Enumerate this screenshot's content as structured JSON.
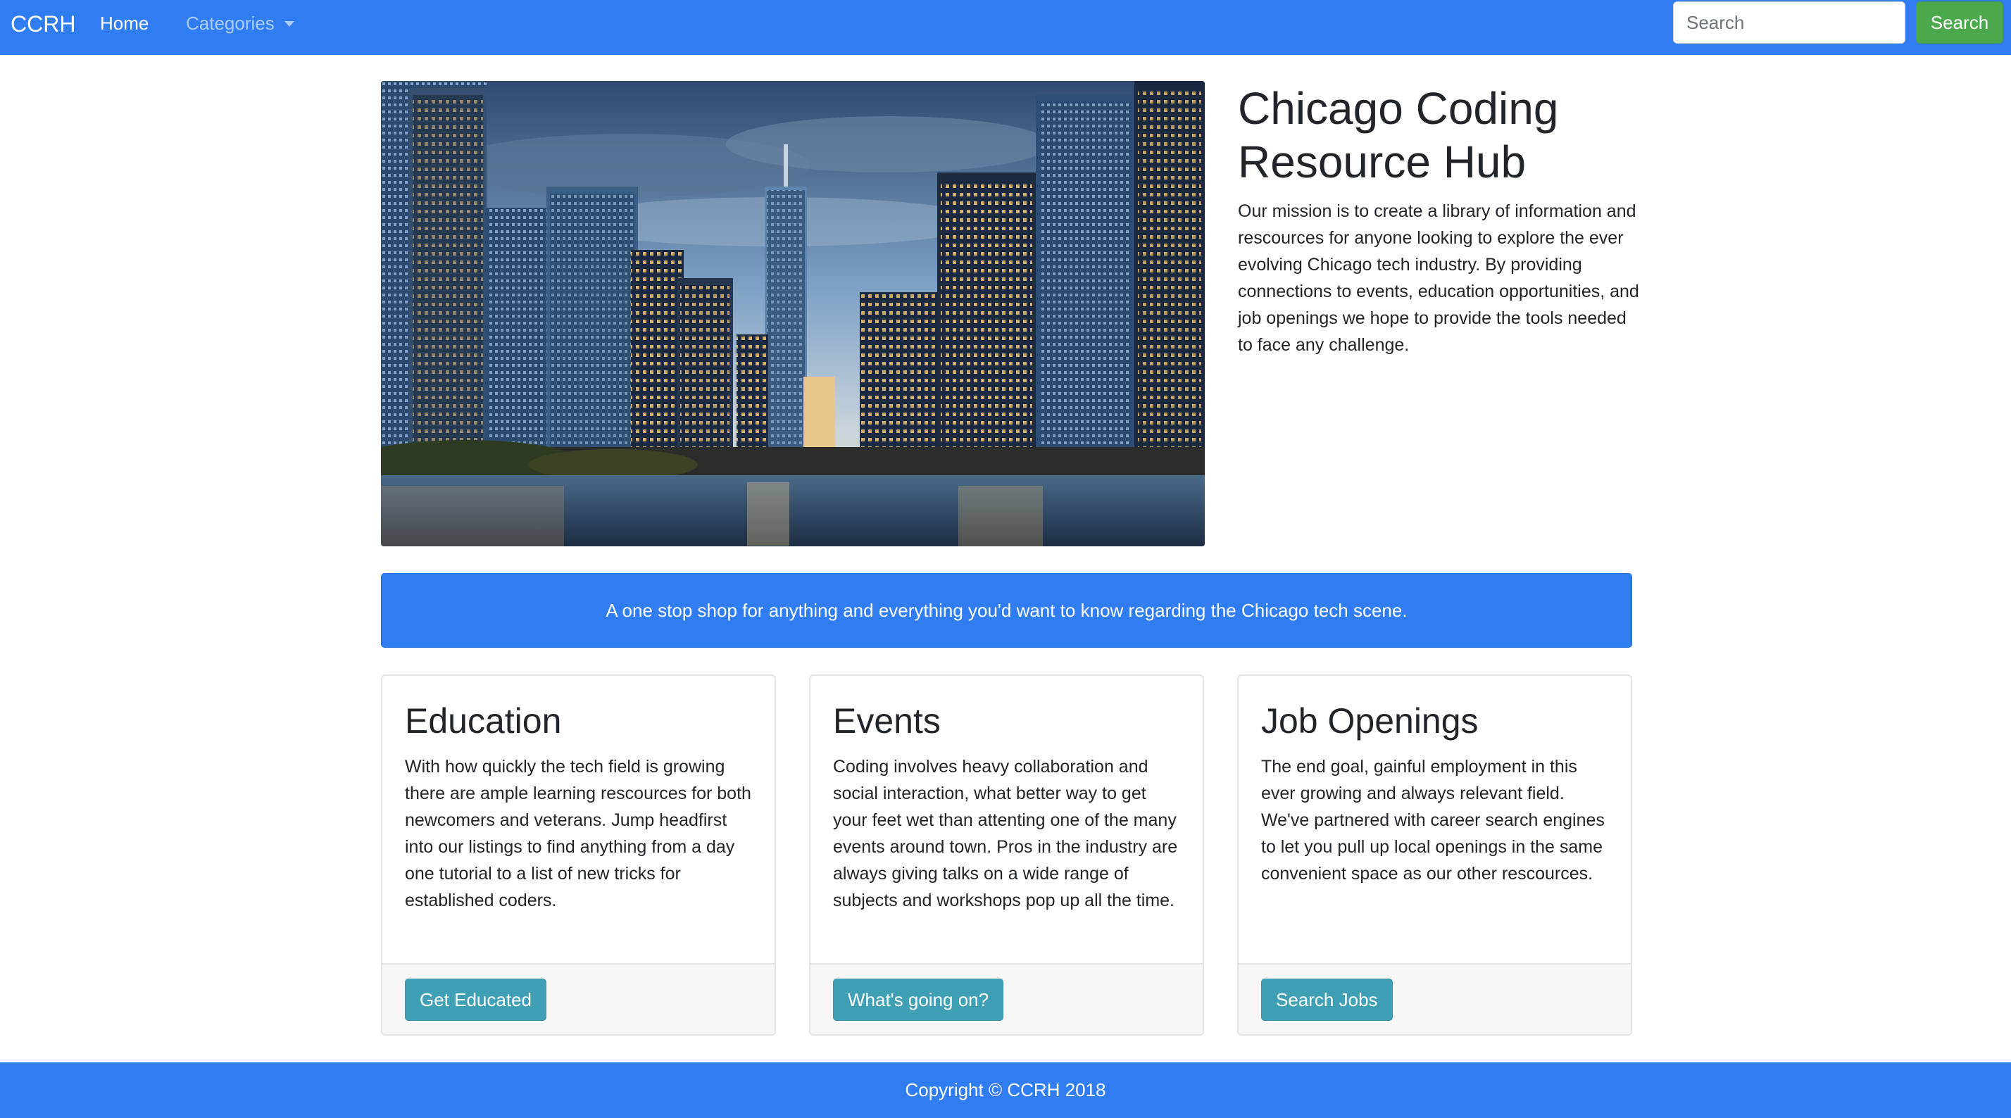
{
  "nav": {
    "brand": "CCRH",
    "home": "Home",
    "categories": "Categories",
    "search_placeholder": "Search",
    "search_button": "Search"
  },
  "hero": {
    "title": "Chicago Coding Resource Hub",
    "text": "Our mission is to create a library of information and rescources for anyone looking to explore the ever evolving Chicago tech industry. By providing connections to events, education opportunities, and job openings we hope to provide the tools needed to face any challenge."
  },
  "tagline": "A one stop shop for anything and everything you'd want to know regarding the Chicago tech scene.",
  "cards": [
    {
      "title": "Education",
      "text": "With how quickly the tech field is growing there are ample learning rescources for both newcomers and veterans. Jump headfirst into our listings to find anything from a day one tutorial to a list of new tricks for established coders.",
      "button": "Get Educated"
    },
    {
      "title": "Events",
      "text": "Coding involves heavy collaboration and social interaction, what better way to get your feet wet than attenting one of the many events around town. Pros in the industry are always giving talks on a wide range of subjects and workshops pop up all the time.",
      "button": "What's going on?"
    },
    {
      "title": "Job Openings",
      "text": "The end goal, gainful employment in this ever growing and always relevant field. We've partnered with career search engines to let you pull up local openings in the same convenient space as our other rescources.",
      "button": "Search Jobs"
    }
  ],
  "footer": "Copyright © CCRH 2018",
  "colors": {
    "primary": "#2f7df0",
    "success": "#4ca84c",
    "info": "#3fa0b5"
  }
}
